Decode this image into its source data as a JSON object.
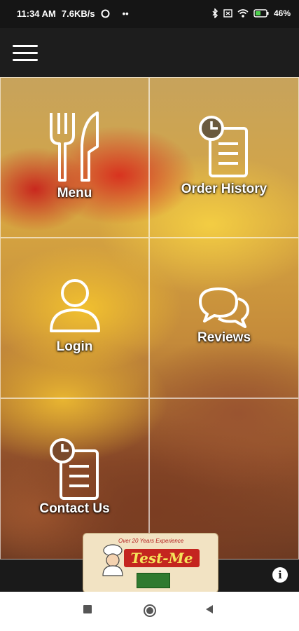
{
  "status_bar": {
    "time": "11:34 AM",
    "network_speed": "7.6KB/s",
    "dots": "••",
    "battery": "46%",
    "icons": [
      "bluetooth-icon",
      "wifi-icon",
      "battery-icon"
    ]
  },
  "app_bar": {
    "menu_icon": "hamburger-icon"
  },
  "tiles": [
    {
      "label": "Menu",
      "icon": "fork-knife-icon"
    },
    {
      "label": "Order History",
      "icon": "clock-document-icon"
    },
    {
      "label": "Login",
      "icon": "user-icon"
    },
    {
      "label": "Reviews",
      "icon": "chat-bubbles-icon"
    },
    {
      "label": "Contact Us",
      "icon": "clock-document-icon"
    },
    {
      "label": "",
      "icon": ""
    }
  ],
  "logo": {
    "tagline": "Over 20 Years Experience",
    "name": "Test-Me"
  },
  "footer": {
    "info_icon": "info-icon",
    "info_label": "i"
  },
  "nav_bar": [
    "recents-square-icon",
    "home-circle-icon",
    "back-triangle-icon"
  ],
  "colors": {
    "status_bar": "#151515",
    "app_bar": "#1d1d1d",
    "logo_red": "#c4251f",
    "logo_bg": "#f2e3c3"
  }
}
